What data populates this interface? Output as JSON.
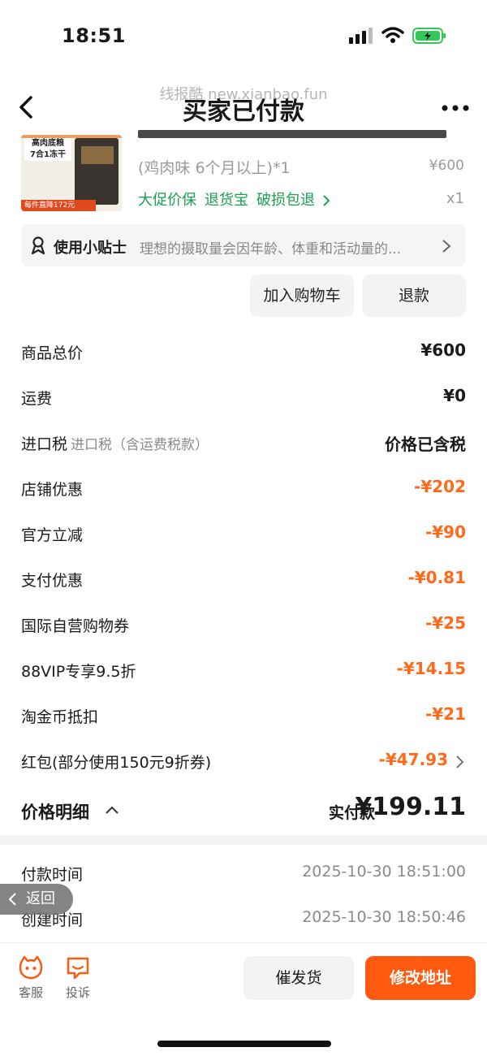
{
  "status_bar": {
    "time": "18:51"
  },
  "nav": {
    "title": "买家已付款",
    "watermark": "线报酷 new.xianbao.fun"
  },
  "product": {
    "thumb_line1": "高肉底粮",
    "thumb_line2": "7合1冻干",
    "thumb_promo": "每件直降172元",
    "spec": "(鸡肉味 6个月以上)*1",
    "unit_price": "¥600",
    "badges": [
      "大促价保",
      "退货宝",
      "破损包退"
    ],
    "qty": "x1"
  },
  "tip": {
    "label": "使用小贴士",
    "text": "理想的摄取量会因年龄、体重和活动量的..."
  },
  "actions": {
    "add_cart": "加入购物车",
    "refund": "退款"
  },
  "price_rows": [
    {
      "label": "商品总价",
      "sub": "",
      "value": "¥600",
      "negative": false
    },
    {
      "label": "运费",
      "sub": "",
      "value": "¥0",
      "negative": false
    },
    {
      "label": "进口税",
      "sub": "进口税（含运费税款）",
      "value": "价格已含税",
      "negative": false
    },
    {
      "label": "店铺优惠",
      "sub": "",
      "value": "-¥202",
      "negative": true
    },
    {
      "label": "官方立减",
      "sub": "",
      "value": "-¥90",
      "negative": true
    },
    {
      "label": "支付优惠",
      "sub": "",
      "value": "-¥0.81",
      "negative": true
    },
    {
      "label": "国际自营购物券",
      "sub": "",
      "value": "-¥25",
      "negative": true
    },
    {
      "label": "88VIP专享9.5折",
      "sub": "",
      "value": "-¥14.15",
      "negative": true
    },
    {
      "label": "淘金币抵扣",
      "sub": "",
      "value": "-¥21",
      "negative": true
    },
    {
      "label": "红包(部分使用150元9折券)",
      "sub": "",
      "value": "-¥47.93",
      "negative": true
    }
  ],
  "summary": {
    "label": "价格明细",
    "paid_label": "实付款",
    "paid_value": "¥199.11"
  },
  "info": [
    {
      "label": "付款时间",
      "value": "2025-10-30 18:51:00"
    },
    {
      "label": "创建时间",
      "value": "2025-10-30 18:50:46"
    }
  ],
  "float_back": "返回",
  "bottom": {
    "service": "客服",
    "complain": "投诉",
    "urge": "催发货",
    "change_address": "修改地址"
  },
  "colors": {
    "accent": "#ff5a10",
    "discount": "#ff6a1a",
    "green": "#1aa050"
  }
}
